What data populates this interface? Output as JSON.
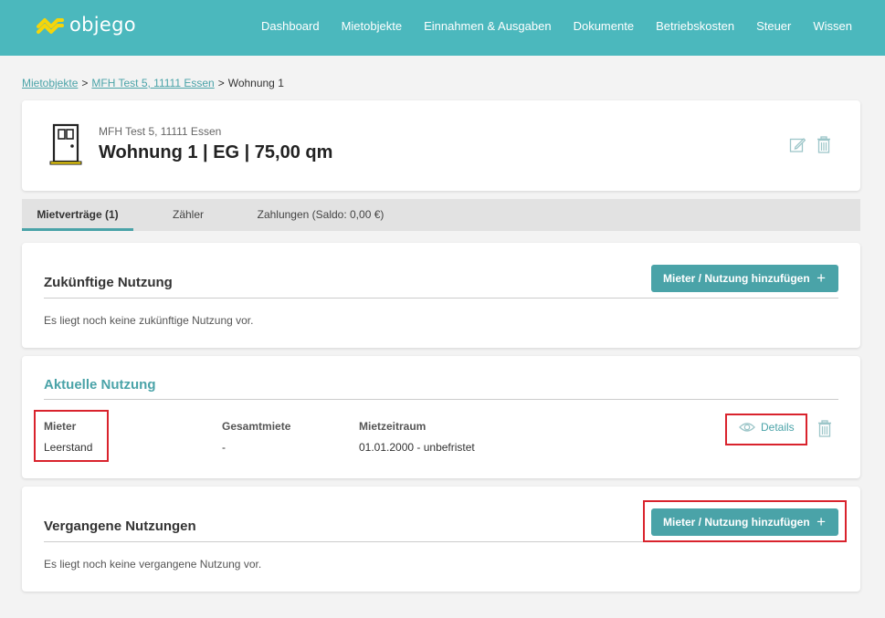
{
  "brand": {
    "name": "objego"
  },
  "nav": [
    "Dashboard",
    "Mietobjekte",
    "Einnahmen & Ausgaben",
    "Dokumente",
    "Betriebskosten",
    "Steuer",
    "Wissen"
  ],
  "breadcrumb": {
    "items": [
      "Mietobjekte",
      "MFH Test 5, 11111 Essen"
    ],
    "current": "Wohnung 1",
    "separator": ">"
  },
  "unit": {
    "building": "MFH Test 5, 11111 Essen",
    "title": "Wohnung 1 | EG | 75,00 qm"
  },
  "tabs": [
    {
      "label": "Mietverträge (1)",
      "active": true
    },
    {
      "label": "Zähler",
      "active": false
    },
    {
      "label": "Zahlungen (Saldo: 0,00 €)",
      "active": false
    }
  ],
  "future": {
    "title": "Zukünftige Nutzung",
    "add_label": "Mieter / Nutzung hinzufügen",
    "empty": "Es liegt noch keine zukünftige Nutzung vor."
  },
  "current": {
    "title": "Aktuelle Nutzung",
    "columns": [
      "Mieter",
      "Gesamtmiete",
      "Mietzeitraum"
    ],
    "row": {
      "tenant": "Leerstand",
      "rent": "-",
      "period": "01.01.2000 - unbefristet"
    },
    "details_label": "Details"
  },
  "past": {
    "title": "Vergangene Nutzungen",
    "add_label": "Mieter / Nutzung hinzufügen",
    "empty": "Es liegt noch keine vergangene Nutzung vor."
  },
  "colors": {
    "header": "#4bb8bd",
    "accent": "#4aa3a8",
    "logo_mark": "#f5d50a",
    "highlight": "#d9232d"
  }
}
